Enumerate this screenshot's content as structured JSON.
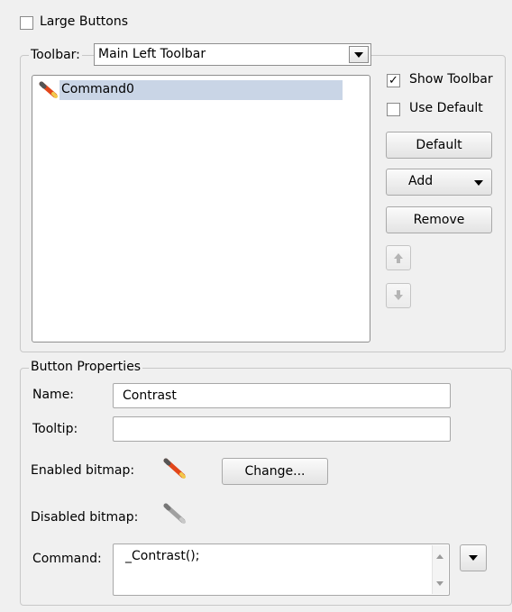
{
  "large_buttons": {
    "label": "Large Buttons",
    "checked": false
  },
  "toolbar": {
    "label": "Toolbar:",
    "selected": "Main Left Toolbar",
    "items": [
      {
        "label": "Command0",
        "icon": "pencil-icon",
        "selected": true
      }
    ],
    "show_toolbar": {
      "label": "Show Toolbar",
      "checked": true
    },
    "use_default": {
      "label": "Use Default",
      "checked": false
    },
    "buttons": {
      "default": "Default",
      "add": "Add",
      "remove": "Remove"
    }
  },
  "button_properties": {
    "title": "Button Properties",
    "name_label": "Name:",
    "name_value": "Contrast",
    "tooltip_label": "Tooltip:",
    "tooltip_value": "",
    "enabled_bitmap_label": "Enabled bitmap:",
    "change_label": "Change...",
    "disabled_bitmap_label": "Disabled bitmap:",
    "command_label": "Command:",
    "command_value": "_Contrast();"
  },
  "colors": {
    "background": "#f0f0f0",
    "list_selection": "#c9d5e6",
    "pencil_enabled": "#e2461a",
    "pencil_disabled": "#a0a0a0"
  }
}
